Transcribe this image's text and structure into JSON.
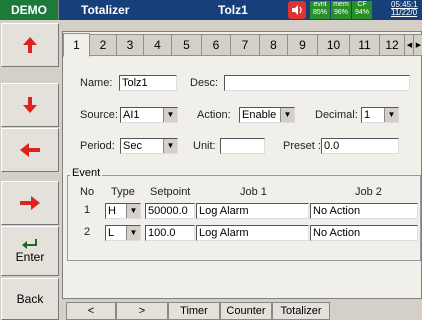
{
  "mode_badge": "DEMO",
  "header": {
    "app_title": "Totalizer",
    "device_name": "Tolz1",
    "status": [
      {
        "label": "evnt",
        "value": "85%"
      },
      {
        "label": "mem",
        "value": "96%"
      },
      {
        "label": "CF",
        "value": "94%"
      }
    ],
    "clock_time": "05:45:1",
    "clock_date": "11/22/0"
  },
  "sidebar": {
    "enter_label": "Enter",
    "back_label": "Back"
  },
  "tabs": [
    "1",
    "2",
    "3",
    "4",
    "5",
    "6",
    "7",
    "8",
    "9",
    "10",
    "11",
    "12"
  ],
  "active_tab": "1",
  "form": {
    "name_label": "Name:",
    "name_value": "Tolz1",
    "desc_label": "Desc:",
    "desc_value": "",
    "source_label": "Source:",
    "source_value": "AI1",
    "action_label": "Action:",
    "action_value": "Enable",
    "decimal_label": "Decimal:",
    "decimal_value": "1",
    "period_label": "Period:",
    "period_value": "Sec",
    "unit_label": "Unit:",
    "unit_value": "",
    "preset_label": "Preset :",
    "preset_value": "0.0"
  },
  "event": {
    "legend": "Event",
    "headers": {
      "no": "No",
      "type": "Type",
      "setpoint": "Setpoint",
      "job1": "Job 1",
      "job2": "Job 2"
    },
    "rows": [
      {
        "no": "1",
        "type": "H",
        "setpoint": "50000.0",
        "job1": "Log Alarm",
        "job2": "No Action"
      },
      {
        "no": "2",
        "type": "L",
        "setpoint": "100.0",
        "job1": "Log Alarm",
        "job2": "No Action"
      }
    ]
  },
  "bottom_tabs": [
    "<",
    ">",
    "Timer",
    "Counter",
    "Totalizer"
  ]
}
